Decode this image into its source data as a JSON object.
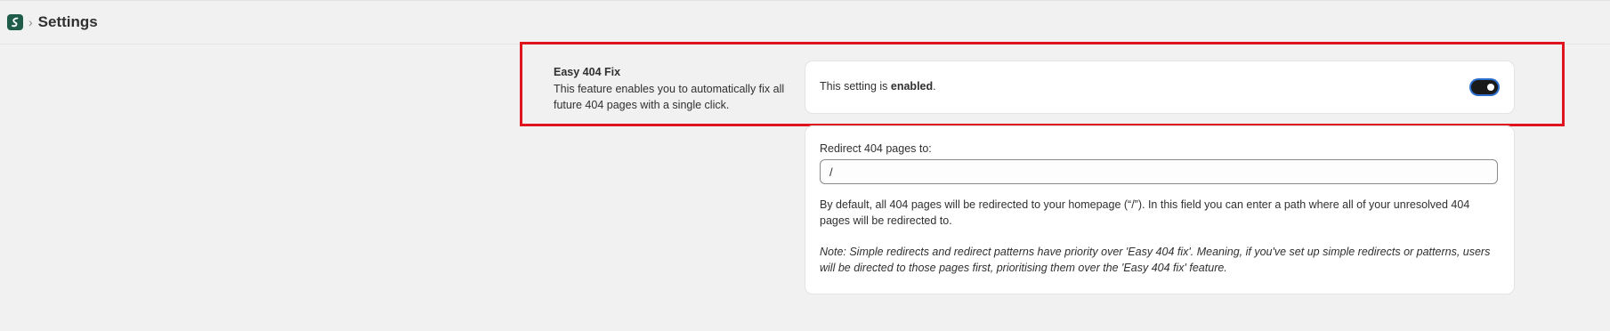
{
  "header": {
    "logo_icon": "app-logo-icon",
    "separator": "›",
    "title": "Settings"
  },
  "section": {
    "title": "Easy 404 Fix",
    "description": "This feature enables you to automatically fix all future 404 pages with a single click."
  },
  "toggle_card": {
    "text_prefix": "This setting is ",
    "status": "enabled",
    "text_suffix": ".",
    "toggle_on": true
  },
  "redirect_card": {
    "label": "Redirect 404 pages to:",
    "input_value": "/",
    "help": "By default, all 404 pages will be redirected to your homepage (“/”). In this field you can enter a path where all of your unresolved 404 pages will be redirected to.",
    "note": "Note: Simple redirects and redirect patterns have priority over 'Easy 404 fix'. Meaning, if you've set up simple redirects or patterns, users will be directed to those pages first, prioritising them over the 'Easy 404 fix' feature."
  },
  "colors": {
    "highlight": "#e0141e",
    "logo_bg": "#1f5c4a",
    "toggle_bg": "#1a1a1a",
    "toggle_focus": "#2c6ecb"
  }
}
